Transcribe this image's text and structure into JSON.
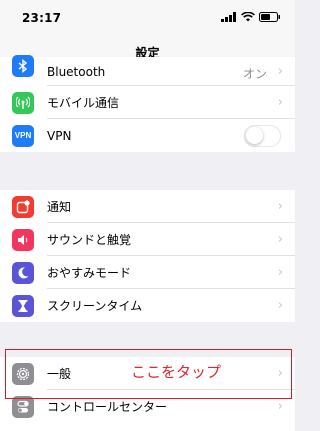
{
  "status_bar": {
    "time": "23:17"
  },
  "nav": {
    "title": "設定"
  },
  "group1": [
    {
      "name": "bluetooth",
      "label": "Bluetooth",
      "value": "オン",
      "icon": "bluetooth-icon",
      "color": "#1f7bf6"
    },
    {
      "name": "mobile-data",
      "label": "モバイル通信",
      "icon": "antenna-icon",
      "color": "#34c759"
    },
    {
      "name": "vpn",
      "label": "VPN",
      "icon": "vpn-icon",
      "color": "#1f7bf6",
      "toggle": false
    }
  ],
  "group2": [
    {
      "name": "notifications",
      "label": "通知",
      "icon": "notification-icon",
      "color": "#f33b30"
    },
    {
      "name": "sounds",
      "label": "サウンドと触覚",
      "icon": "speaker-icon",
      "color": "#f2365d"
    },
    {
      "name": "do-not-disturb",
      "label": "おやすみモード",
      "icon": "moon-icon",
      "color": "#5a55d6"
    },
    {
      "name": "screen-time",
      "label": "スクリーンタイム",
      "icon": "hourglass-icon",
      "color": "#5a55d6"
    }
  ],
  "group3": [
    {
      "name": "general",
      "label": "一般",
      "icon": "gear-icon",
      "color": "#8e8e93"
    },
    {
      "name": "control-center",
      "label": "コントロールセンター",
      "icon": "switches-icon",
      "color": "#8e8e93"
    }
  ],
  "annotation": {
    "note": "ここをタップ",
    "color": "#d81b2b"
  }
}
